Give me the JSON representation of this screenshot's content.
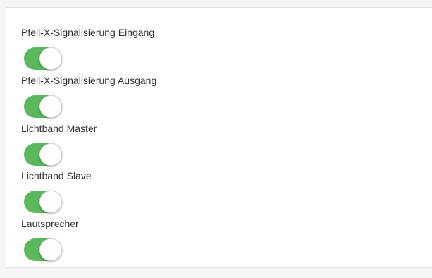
{
  "colors": {
    "toggle_on": "#5cb85c",
    "panel_background": "#ffffff",
    "page_background": "#f5f5f5",
    "label_text": "#333333"
  },
  "settings": [
    {
      "label": "Pfeil-X-Signalisierung Eingang",
      "enabled": true
    },
    {
      "label": "Pfeil-X-Signalisierung Ausgang",
      "enabled": true
    },
    {
      "label": "Lichtband Master",
      "enabled": true
    },
    {
      "label": "Lichtband Slave",
      "enabled": true
    },
    {
      "label": "Lautsprecher",
      "enabled": true
    }
  ]
}
